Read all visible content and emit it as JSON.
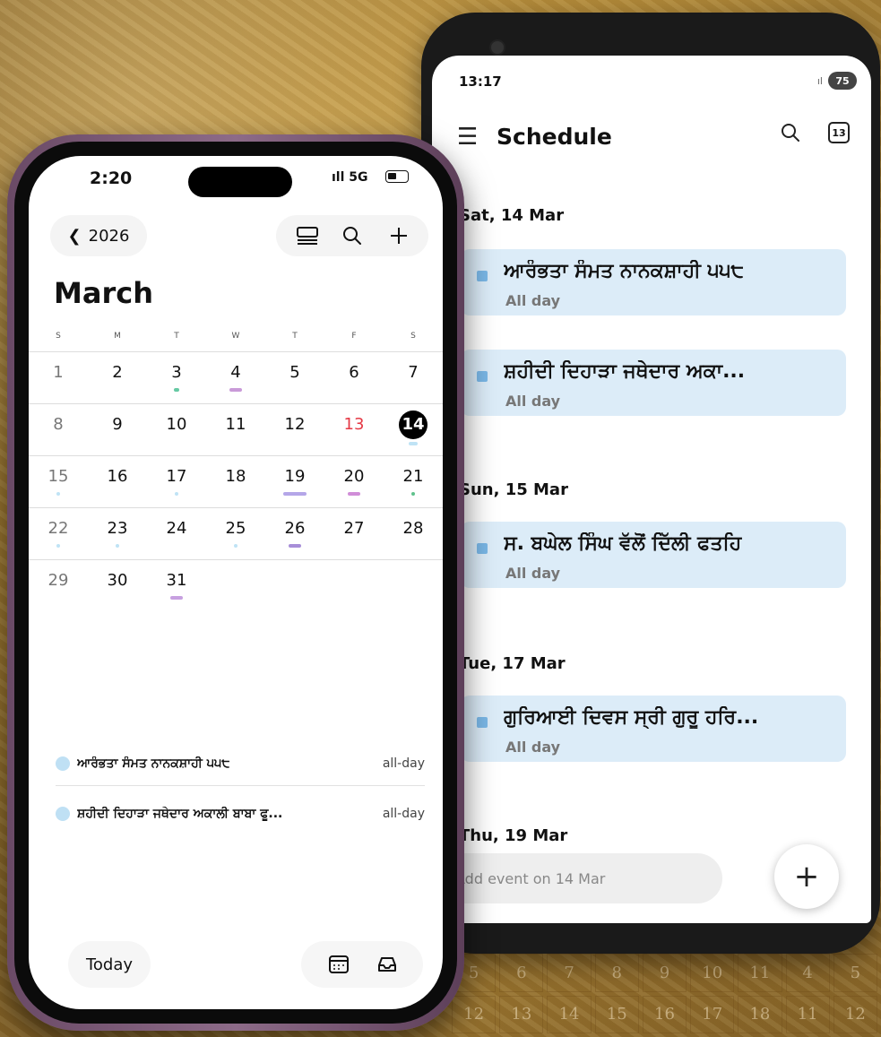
{
  "android": {
    "status_time": "13:17",
    "signal": "ıl",
    "battery": "75",
    "title": "Schedule",
    "calendar_day": "13",
    "groups": [
      {
        "date": "Sat, 14 Mar",
        "events": [
          {
            "title": "ਆਰੰਭਤਾ ਸੰਮਤ ਨਾਨਕਸ਼ਾਹੀ ੫੫੮",
            "sub": "All day"
          },
          {
            "title": "ਸ਼ਹੀਦੀ ਦਿਹਾੜਾ ਜਥੇਦਾਰ ਅਕਾ...",
            "sub": "All day"
          }
        ]
      },
      {
        "date": "Sun, 15 Mar",
        "events": [
          {
            "title": "ਸ. ਬਘੇਲ ਸਿੰਘ ਵੱਲੋਂ ਦਿੱਲੀ ਫਤਹਿ",
            "sub": "All day"
          }
        ]
      },
      {
        "date": "Tue, 17 Mar",
        "events": [
          {
            "title": "ਗੁਰਿਆਈ ਦਿਵਸ ਸ੍ਰੀ ਗੁਰੂ ਹਰਿ...",
            "sub": "All day"
          }
        ]
      },
      {
        "date": "Thu, 19 Mar",
        "events": []
      }
    ],
    "add_placeholder": "Add event on 14 Mar",
    "fab": "+"
  },
  "iphone": {
    "status_time": "2:20",
    "signal": "ıll 5G",
    "back_label": "2026",
    "month": "March",
    "dow": [
      "S",
      "M",
      "T",
      "W",
      "T",
      "F",
      "S"
    ],
    "weeks": [
      [
        "1",
        "2",
        "3",
        "4",
        "5",
        "6",
        "7"
      ],
      [
        "8",
        "9",
        "10",
        "11",
        "12",
        "13",
        "14"
      ],
      [
        "15",
        "16",
        "17",
        "18",
        "19",
        "20",
        "21"
      ],
      [
        "22",
        "23",
        "24",
        "25",
        "26",
        "27",
        "28"
      ],
      [
        "29",
        "30",
        "31",
        "",
        "",
        "",
        ""
      ]
    ],
    "selected_day": "14",
    "red_day": "13",
    "events": [
      {
        "title": "ਆਰੰਭਤਾ ਸੰਮਤ ਨਾਨਕਸ਼ਾਹੀ ੫੫੮",
        "allday": "all-day"
      },
      {
        "title": "ਸ਼ਹੀਦੀ ਦਿਹਾੜਾ ਜਥੇਦਾਰ ਅਕਾਲੀ ਬਾਬਾ ਫੂ...",
        "allday": "all-day"
      }
    ],
    "today_label": "Today"
  },
  "background": {
    "grid": [
      "5",
      "6",
      "7",
      "8",
      "9",
      "10",
      "11",
      "4",
      "5",
      "12",
      "13",
      "14",
      "15",
      "16",
      "17",
      "18",
      "11",
      "12"
    ]
  },
  "colors": {
    "event_card": "#dcecf8",
    "event_dot": "#bfe0f4",
    "red": "#e53945",
    "today_circle": "#000000"
  }
}
